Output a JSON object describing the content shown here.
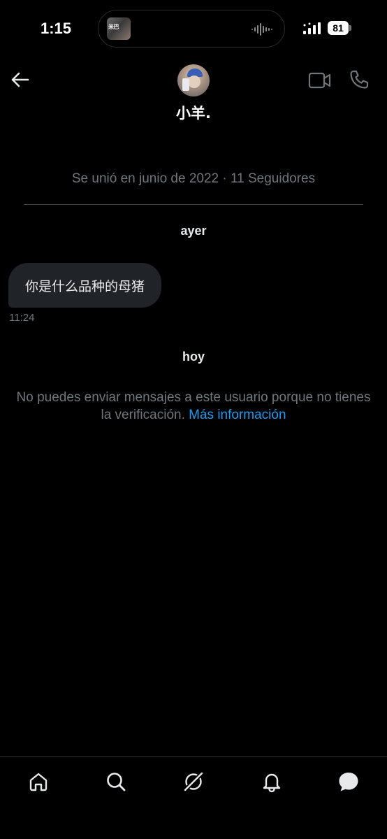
{
  "status_bar": {
    "time": "1:15",
    "battery": "81",
    "island_art_text": "米巴"
  },
  "header": {
    "name": "小羊."
  },
  "profile_info": {
    "joined": "Se unió en junio de 2022 · 11 Seguidores"
  },
  "conversation": {
    "day_1": "ayer",
    "messages": [
      {
        "text": "你是什么品种的母猪",
        "time": "11:24"
      }
    ],
    "day_2": "hoy",
    "notice_text": "No puedes enviar mensajes a este usuario porque no tienes la verificación.",
    "notice_link": "Más información"
  },
  "bottom_nav": {
    "items": [
      "home-icon",
      "search-icon",
      "grok-icon",
      "notifications-icon",
      "messages-icon"
    ]
  },
  "colors": {
    "background": "#000000",
    "bubble": "#202327",
    "muted_text": "#71767b",
    "link": "#1d9bf0"
  }
}
